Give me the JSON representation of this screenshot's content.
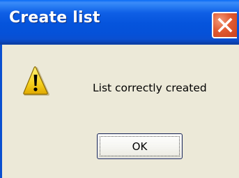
{
  "dialog": {
    "title": "Create list",
    "message": "List correctly created",
    "ok_label": "OK"
  },
  "icons": {
    "warning": "warning-icon",
    "close": "close-icon"
  },
  "colors": {
    "titlebar": "#0554dc",
    "close_button": "#e05a32",
    "dialog_background": "#ece9d8"
  }
}
